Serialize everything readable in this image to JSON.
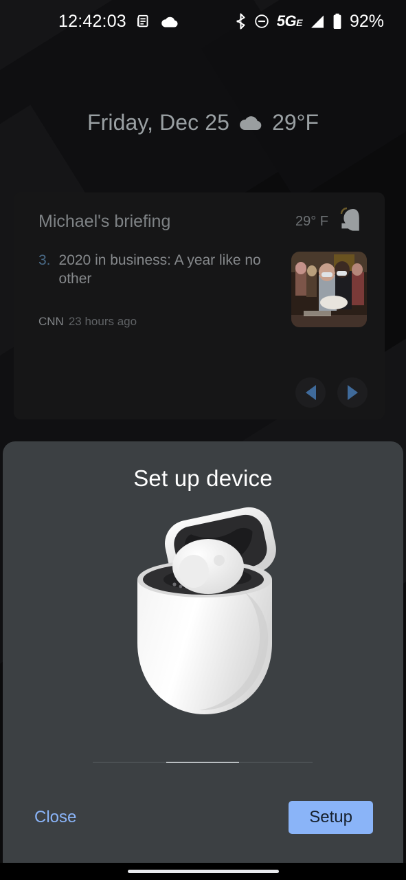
{
  "status_bar": {
    "time": "12:42:03",
    "left_icons": [
      {
        "name": "news-article-icon"
      },
      {
        "name": "cloud-icon"
      }
    ],
    "right_icons": [
      {
        "name": "bluetooth-icon"
      },
      {
        "name": "do-not-disturb-icon"
      },
      {
        "name": "signal-icon"
      },
      {
        "name": "battery-icon"
      }
    ],
    "network_label": "5G",
    "network_sub": "E",
    "battery_percent": "92%"
  },
  "date_widget": {
    "date": "Friday, Dec 25",
    "weather_icon": "cloud-icon",
    "temperature": "29°F"
  },
  "briefing": {
    "title": "Michael's briefing",
    "temperature": "29° F",
    "avatar_icon": "person-avatar-icon",
    "article": {
      "number": "3.",
      "headline": "2020 in business: A year like no other",
      "source": "CNN",
      "age": "23 hours ago",
      "thumbnail_alt": "crowd-of-people-photo"
    },
    "prev_label": "previous",
    "next_label": "next"
  },
  "dialog": {
    "title": "Set up device",
    "device_image": "pixel-buds-charging-case",
    "pager": {
      "total": 3,
      "current": 2
    },
    "close_label": "Close",
    "setup_label": "Setup"
  },
  "colors": {
    "accent_blue": "#8ab4f8",
    "dialog_bg": "#3c4043",
    "card_bg": "#161617",
    "wallpaper_bg": "#0b0b0c",
    "text_primary": "#ffffff",
    "text_secondary": "#9aa0a3"
  },
  "nav": {
    "gesture_pill": "home-gesture-pill"
  }
}
